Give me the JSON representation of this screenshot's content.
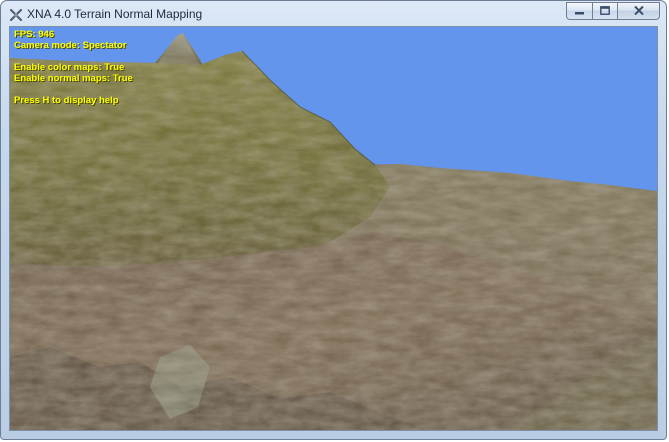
{
  "window": {
    "title": "XNA 4.0 Terrain Normal Mapping",
    "icon": "xna-app-icon",
    "buttons": {
      "minimize_icon": "minimize-icon",
      "maximize_icon": "maximize-icon",
      "close_icon": "close-icon"
    }
  },
  "hud": {
    "fps": "FPS: 946",
    "camera_mode": "Camera mode: Spectator",
    "color_maps": "Enable color maps: True",
    "normal_maps": "Enable normal maps: True",
    "help": "Press H to display help"
  },
  "colors": {
    "sky": "#6495ed",
    "hud_text": "#ffff00",
    "grass": "#6b6a2a",
    "rock": "#7a6a4e"
  }
}
